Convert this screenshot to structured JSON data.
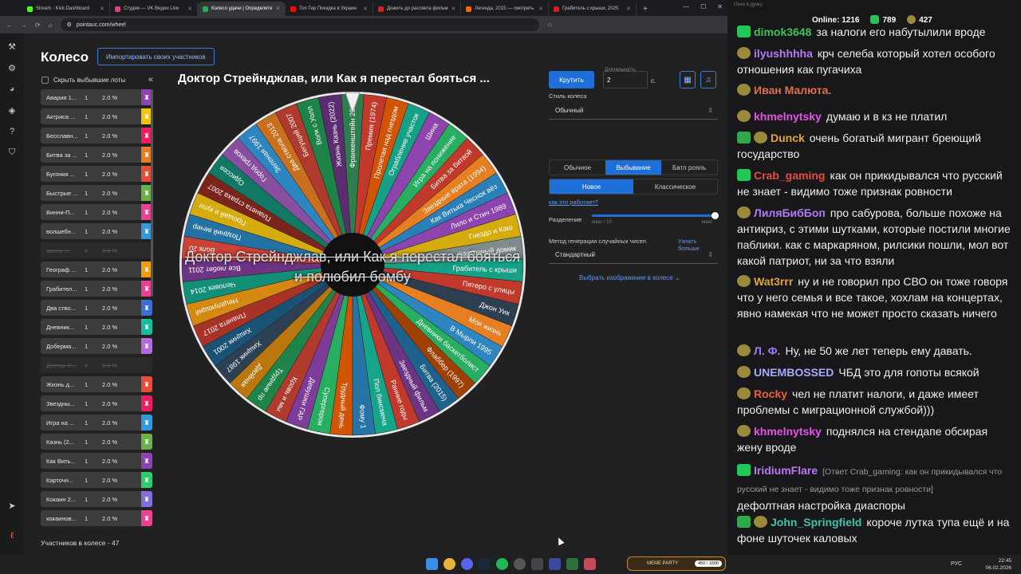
{
  "tabs": [
    {
      "label": "Stream - Kick Dashboard",
      "color": "#53fc18"
    },
    {
      "label": "Студия — VK Видео Live",
      "color": "#e0408a"
    },
    {
      "label": "Колесо удачи | Определите",
      "color": "#36a852",
      "active": true
    },
    {
      "label": "Топ Гир Поездка в Украин",
      "color": "#ff0000"
    },
    {
      "label": "Дожить до рассвета фильм",
      "color": "#cc2222"
    },
    {
      "label": "Легенда, 2015 — смотреть",
      "color": "#ff6600"
    },
    {
      "label": "Грабитель с крыши, 2025",
      "color": "#cc2222"
    }
  ],
  "url": "pointauc.com/wheel",
  "page": {
    "title": "Колесо",
    "import_label": "Импортировать своих участников",
    "hide_label": "Скрыть выбывшие лоты",
    "collapse_glyph": "«",
    "count_label": "Участников в колесе - 47"
  },
  "lots": [
    {
      "name": "Авария 1...",
      "amount": "1",
      "percent": "2.0 %",
      "color": "#8e44ad"
    },
    {
      "name": "Актриса ...",
      "amount": "1",
      "percent": "2.0 %",
      "color": "#f1c40f"
    },
    {
      "name": "Бесславн...",
      "amount": "1",
      "percent": "2.0 %",
      "color": "#e91e63"
    },
    {
      "name": "Битва за ...",
      "amount": "1",
      "percent": "2.0 %",
      "color": "#e67e22"
    },
    {
      "name": "Бугония ...",
      "amount": "1",
      "percent": "2.0 %",
      "color": "#e74c3c"
    },
    {
      "name": "Быстрые ...",
      "amount": "1",
      "percent": "2.0 %",
      "color": "#6ab04c"
    },
    {
      "name": "Винни-П...",
      "amount": "1",
      "percent": "2.0 %",
      "color": "#e84393"
    },
    {
      "name": "волшебн...",
      "amount": "1",
      "percent": "2.0 %",
      "color": "#3498db"
    },
    {
      "name": "врата -...",
      "amount": "1",
      "percent": "2.0 %",
      "color": "#2a2a2a",
      "out": true
    },
    {
      "name": "Географ ...",
      "amount": "1",
      "percent": "2.0 %",
      "color": "#f39c12"
    },
    {
      "name": "Грабител...",
      "amount": "1",
      "percent": "2.0 %",
      "color": "#e84393"
    },
    {
      "name": "Два ство...",
      "amount": "1",
      "percent": "2.0 %",
      "color": "#3b6fd6"
    },
    {
      "name": "Дневник...",
      "amount": "1",
      "percent": "2.0 %",
      "color": "#1abc9c"
    },
    {
      "name": "Доберма...",
      "amount": "1",
      "percent": "2.0 %",
      "color": "#b56bd6"
    },
    {
      "name": "Доктор С...",
      "amount": "1",
      "percent": "2.0 %",
      "color": "#2a2a2a",
      "out": true
    },
    {
      "name": "Жизнь д...",
      "amount": "1",
      "percent": "2.0 %",
      "color": "#e74c3c"
    },
    {
      "name": "Звездны...",
      "amount": "1",
      "percent": "2.0 %",
      "color": "#e91e63"
    },
    {
      "name": "Игра на ...",
      "amount": "1",
      "percent": "2.0 %",
      "color": "#3498db"
    },
    {
      "name": "Казнь (2...",
      "amount": "1",
      "percent": "2.0 %",
      "color": "#6ab04c"
    },
    {
      "name": "Как Вить...",
      "amount": "1",
      "percent": "2.0 %",
      "color": "#8e44ad"
    },
    {
      "name": "Карточн...",
      "amount": "1",
      "percent": "2.0 %",
      "color": "#2ecc71"
    },
    {
      "name": "Кокаин 2...",
      "amount": "1",
      "percent": "2.0 %",
      "color": "#7f6fd6"
    },
    {
      "name": "кокаинов...",
      "amount": "1",
      "percent": "2.0 %",
      "color": "#e84393"
    }
  ],
  "wheel": {
    "title": "Доктор Стрейнджлав, или Как я перестал бояться ...",
    "winner": "Доктор Стрейнджлав, или Как я перестал бояться и полюбил бомбу",
    "sectors": [
      {
        "label": "Франкенштейн 2025",
        "color": "#2e7d4f"
      },
      {
        "label": "Премия (1974)",
        "color": "#c0392b"
      },
      {
        "label": "Пролетая над гнездом",
        "color": "#d35400"
      },
      {
        "label": "Ограбление участок",
        "color": "#16a085"
      },
      {
        "label": "Шина",
        "color": "#8e44ad"
      },
      {
        "label": "Игра на понижение",
        "color": "#27ae60"
      },
      {
        "label": "Битва за битвой",
        "color": "#c0392b"
      },
      {
        "label": "Звездные врата (1994)",
        "color": "#e67e22"
      },
      {
        "label": "Как Витька Чеснок вёз",
        "color": "#2980b9"
      },
      {
        "label": "Лило и Стич 1989",
        "color": "#8e44ad"
      },
      {
        "label": "Гнездо и Каш",
        "color": "#d4ac0d"
      },
      {
        "label": "Карточный домик",
        "color": "#7f8c8d"
      },
      {
        "label": "Грабитель с крыши",
        "color": "#16a085"
      },
      {
        "label": "Пятеро с улицы",
        "color": "#c0392b"
      },
      {
        "label": "Джон Уик",
        "color": "#2c3e50"
      },
      {
        "label": "Моя жизнь",
        "color": "#e67e22"
      },
      {
        "label": "В Мырли 1995",
        "color": "#2e86c1"
      },
      {
        "label": "Дневники баскетболист",
        "color": "#27ae60"
      },
      {
        "label": "Флаббер (1997)",
        "color": "#a04000"
      },
      {
        "label": "Битва (2015)",
        "color": "#1f618d"
      },
      {
        "label": "Звездный фильм",
        "color": "#6c3483"
      },
      {
        "label": "Ранние годы",
        "color": "#c0392b"
      },
      {
        "label": "Пол бинсмена",
        "color": "#17a589"
      },
      {
        "label": "Фому 1",
        "color": "#2874a6"
      },
      {
        "label": "Трудный день",
        "color": "#d35400"
      },
      {
        "label": "Супергерои",
        "color": "#27ae60"
      },
      {
        "label": "Девушки ГАР",
        "color": "#7d3c98"
      },
      {
        "label": "Кровь и мы",
        "color": "#b03a2e"
      },
      {
        "label": "Трудные пр",
        "color": "#1e8449"
      },
      {
        "label": "Двойная",
        "color": "#b9770e"
      },
      {
        "label": "Хищник 1987",
        "color": "#2e4053"
      },
      {
        "label": "Хищник 2001",
        "color": "#1a5276"
      },
      {
        "label": "Планета 2017",
        "color": "#a93226"
      },
      {
        "label": "Нецелующий",
        "color": "#d68910"
      },
      {
        "label": "Человек 2014",
        "color": "#148f77"
      },
      {
        "label": "Все любят 2011",
        "color": "#6c3483"
      },
      {
        "label": "Волк 20",
        "color": "#cb4335"
      },
      {
        "label": "Поздний вечер",
        "color": "#2471a3"
      },
      {
        "label": "Прощай и купи",
        "color": "#d4ac0d"
      },
      {
        "label": "Планета страха 2007",
        "color": "#7b241c"
      },
      {
        "label": "Одиссея",
        "color": "#117864"
      },
      {
        "label": "Город грехов",
        "color": "#884ea0"
      },
      {
        "label": "Зеленая 1997",
        "color": "#2e86c1"
      },
      {
        "label": "Два ствола 2013",
        "color": "#ca6f1e"
      },
      {
        "label": "Бегущий 2007",
        "color": "#b03a2e"
      },
      {
        "label": "Волк с Уолл",
        "color": "#1d8348"
      },
      {
        "label": "Жизнь Казнь (2022)",
        "color": "#5b2c6f"
      }
    ]
  },
  "controls": {
    "spin_label": "Крутить",
    "duration_label": "Длительность",
    "duration_value": "2",
    "seconds_suffix": "с.",
    "style_label": "Стиль колеса",
    "style_value": "Обычный",
    "modes": [
      "Обычное",
      "Выбывание",
      "Батл рояль"
    ],
    "active_mode": "Выбывание",
    "variants": [
      "Новое",
      "Классическое"
    ],
    "active_variant": "Новое",
    "how_link": "как это работает?",
    "split_label": "Разделение",
    "split_min": "макс / 10",
    "split_max": "макс",
    "split_level": 1.0,
    "rng_label": "Метод генерации случайных чисел",
    "rng_more": "Узнать больше",
    "rng_value": "Стандартный",
    "image_select": "Выбрать изображение в колесе"
  },
  "chat": {
    "window_title": "Окно в дуэку",
    "online_label": "Online: 1216",
    "stat1": "789",
    "stat2": "427",
    "messages": [
      {
        "badges": [
          "k"
        ],
        "user": "dimok3648",
        "color": "#3ec25a",
        "text": "за налоги его набутылили вроде"
      },
      {
        "badges": [
          "h"
        ],
        "user": "ilyushhhha",
        "color": "#b57af2",
        "text": "крч селеба который хотел особого отношения как пугачиха"
      },
      {
        "badges": [
          "h"
        ],
        "user": "Иван Малюта.",
        "color": "#e36e4c",
        "text": ""
      },
      {
        "badges": [
          "h"
        ],
        "user": "khmelnytsky",
        "color": "#e552e5",
        "text": "думаю и в кз не платил"
      },
      {
        "badges": [
          "c",
          "h"
        ],
        "user": "Dunck",
        "color": "#e8a23a",
        "text": "очень богатый мигрант бреющий государство"
      },
      {
        "badges": [
          "k"
        ],
        "user": "Crab_gaming",
        "color": "#e84c3d",
        "text": "как он прикидывался что русский не знает - видимо тоже признак ровности"
      },
      {
        "badges": [
          "h"
        ],
        "user": "ЛиляБибБоп",
        "color": "#b07cf5",
        "text": "про сабурова, больше похоже на антикриз, с этими шутками, которые постили многие паблики. как с маркаряном, рилсики пошли, мол вот какой патриот, ни за что взяли"
      },
      {
        "badges": [
          "h"
        ],
        "user": "Wat3rrr",
        "color": "#e8a23a",
        "text": "ну и не говорил про СВО он тоже говоря что у него семья и все такое, хохлам на концертах, явно намекая что не может просто сказать ничего"
      },
      {
        "badges": [
          "h"
        ],
        "user": "Л. Ф.",
        "color": "#9c7cf5",
        "text": "Ну, не 50 же лет теперь ему давать."
      },
      {
        "badges": [
          "h"
        ],
        "user": "UNEMBOSSED",
        "color": "#a9a9ff",
        "text": "ЧБД это для гопоты всякой"
      },
      {
        "badges": [
          "h"
        ],
        "user": "Rocky",
        "color": "#e8623a",
        "text": "чел не платит налоги, и даже имеет проблемы с миграционной службой)))"
      },
      {
        "badges": [
          "h"
        ],
        "user": "khmelnytsky",
        "color": "#e552e5",
        "text": "поднялся на стендапе обсирая жену вроде"
      },
      {
        "badges": [
          "k"
        ],
        "user": "IridiumFlare",
        "color": "#b57af2",
        "reply": "[Ответ Crab_gaming: как он прикидывался что русский не знает - видимо тоже признак ровности]",
        "text": "дефолтная настройка диаспоры"
      },
      {
        "badges": [
          "c",
          "h"
        ],
        "user": "John_Springfield",
        "color": "#3ec2a8",
        "text": "короче лутка тупа ещё и на фоне шуточек каловых"
      }
    ]
  },
  "taskbar": {
    "meme_label": "MEME PARTY",
    "meme_count": "450 / 1500",
    "lang": "РУС",
    "time": "22:45",
    "date": "06.02.2026"
  }
}
